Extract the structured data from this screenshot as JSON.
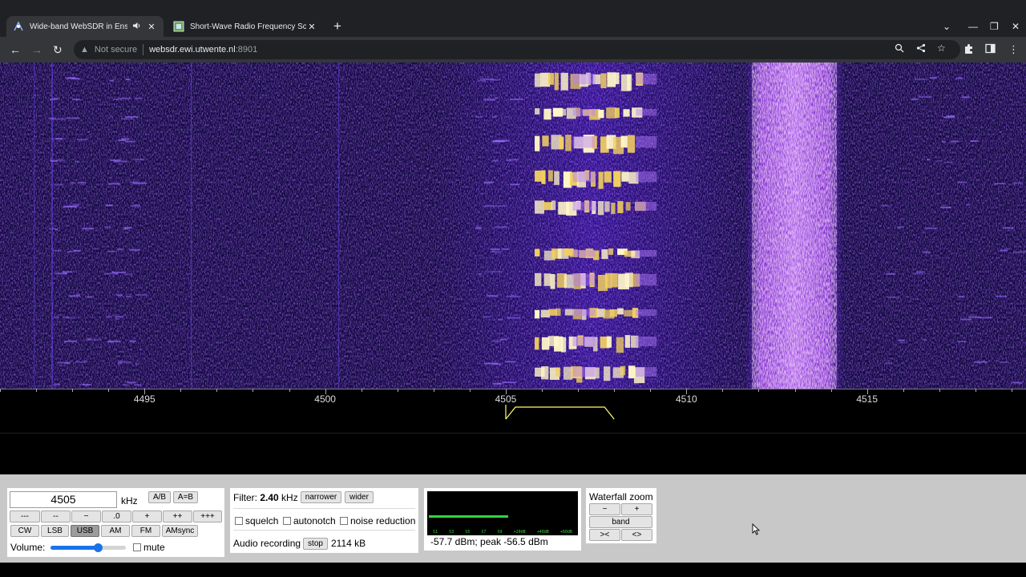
{
  "browser": {
    "tabs": [
      {
        "title": "Wide-band WebSDR in Ensch",
        "active": true,
        "audio": true
      },
      {
        "title": "Short-Wave Radio Frequency Sch",
        "active": false,
        "audio": false
      }
    ],
    "url": {
      "security_label": "Not secure",
      "host": "websdr.ewi.utwente.nl",
      "port": ":8901"
    }
  },
  "waterfall": {
    "frequency_scale": {
      "unit": "kHz",
      "labels": [
        "4495",
        "4500",
        "4505",
        "4510",
        "4515"
      ],
      "visible_range_khz": [
        4491.0,
        4519.4
      ]
    },
    "passband_khz": [
      4505.0,
      4508.0
    ]
  },
  "controls": {
    "frequency": {
      "value": "4505",
      "unit": "kHz",
      "ab_label": "A/B",
      "aeqb_label": "A=B"
    },
    "step_buttons": [
      "---",
      "--",
      "−",
      ".0",
      "+",
      "++",
      "+++"
    ],
    "modes": [
      "CW",
      "LSB",
      "USB",
      "AM",
      "FM",
      "AMsync"
    ],
    "selected_mode": "USB",
    "volume": {
      "label": "Volume:",
      "level": 0.63,
      "mute_label": "mute",
      "muted": false
    },
    "filter": {
      "label": "Filter:",
      "value": "2.40",
      "unit": "kHz",
      "narrower_label": "narrower",
      "wider_label": "wider",
      "squelch_label": "squelch",
      "autonotch_label": "autonotch",
      "noise_reduction_label": "noise reduction"
    },
    "audio_recording": {
      "label": "Audio recording",
      "stop_label": "stop",
      "size": "2114 kB"
    },
    "smeter": {
      "readout": "-57.7 dBm; peak  -56.5 dBm",
      "scale": [
        "S1",
        "S3",
        "S5",
        "S7",
        "S9",
        "+20dB",
        "+40dB",
        "+60dB"
      ],
      "level": 0.54
    },
    "waterfall_zoom": {
      "title": "Waterfall zoom",
      "minus_label": "−",
      "plus_label": "+",
      "band_label": "band",
      "shrink_label": "><",
      "expand_label": "<>"
    }
  }
}
